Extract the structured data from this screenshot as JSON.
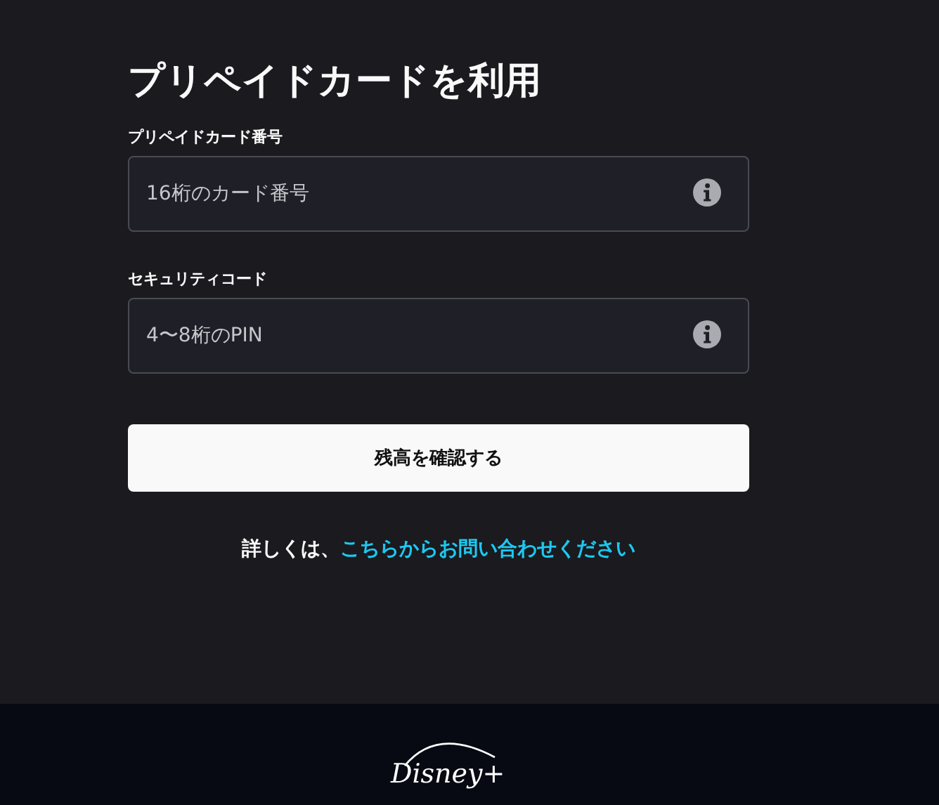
{
  "title": "プリペイドカードを利用",
  "fields": [
    {
      "label": "プリペイドカード番号",
      "placeholder": "16桁のカード番号"
    },
    {
      "label": "セキュリティコード",
      "placeholder": "4〜8桁のPIN"
    }
  ],
  "button": "残高を確認する",
  "help": {
    "text": "詳しくは、",
    "link": "こちらからお問い合わせください"
  },
  "footer": {
    "logo": "Disney+"
  }
}
